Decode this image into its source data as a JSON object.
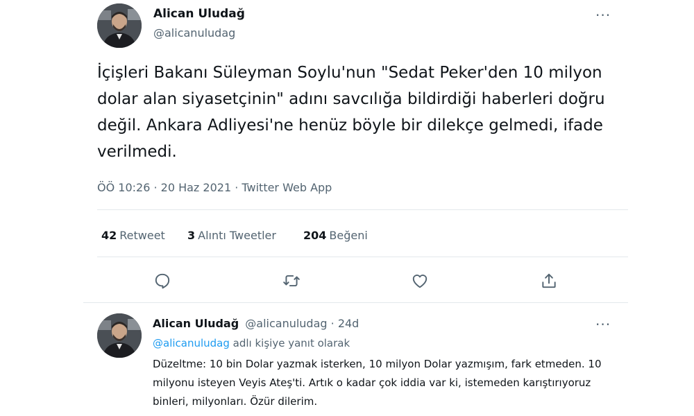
{
  "main_tweet": {
    "author_name": "Alican Uludağ",
    "author_handle": "@alicanuludag",
    "text": "İçişleri Bakanı Süleyman Soylu'nun \"Sedat Peker'den 10 milyon dolar alan siyasetçinin\" adını savcılığa bildirdiği haberleri doğru değil. Ankara Adliyesi'ne henüz böyle bir dilekçe gelmedi, ifade verilmedi.",
    "meta": "ÖÖ 10:26 · 20 Haz 2021 · Twitter Web App",
    "more_label": "···",
    "stats": [
      {
        "count": "42",
        "label": "Retweet"
      },
      {
        "count": "3",
        "label": "Alıntı Tweetler"
      },
      {
        "count": "204",
        "label": "Beğeni"
      }
    ],
    "actions": [
      {
        "icon": "reply-icon"
      },
      {
        "icon": "retweet-icon"
      },
      {
        "icon": "like-icon"
      },
      {
        "icon": "share-icon"
      }
    ]
  },
  "reply_tweet": {
    "author_name": "Alican Uludağ",
    "author_handle": "@alicanuludag",
    "time": "· 24d",
    "more_label": "···",
    "replying_to_mention": "@alicanuludag",
    "replying_to_suffix": "adlı kişiye yanıt olarak",
    "text": "Düzeltme: 10 bin Dolar yazmak isterken, 10 milyon Dolar yazmışım, fark etmeden. 10 milyonu isteyen Veyis Ateş'ti. Artık o kadar çok iddia var ki, istemeden karıştırıyoruz binleri, milyonları. Özür dilerim."
  },
  "colors": {
    "text_primary": "#0f1419",
    "text_secondary": "#536471",
    "accent": "#1d9bf0",
    "divider": "#e3e8ec"
  }
}
